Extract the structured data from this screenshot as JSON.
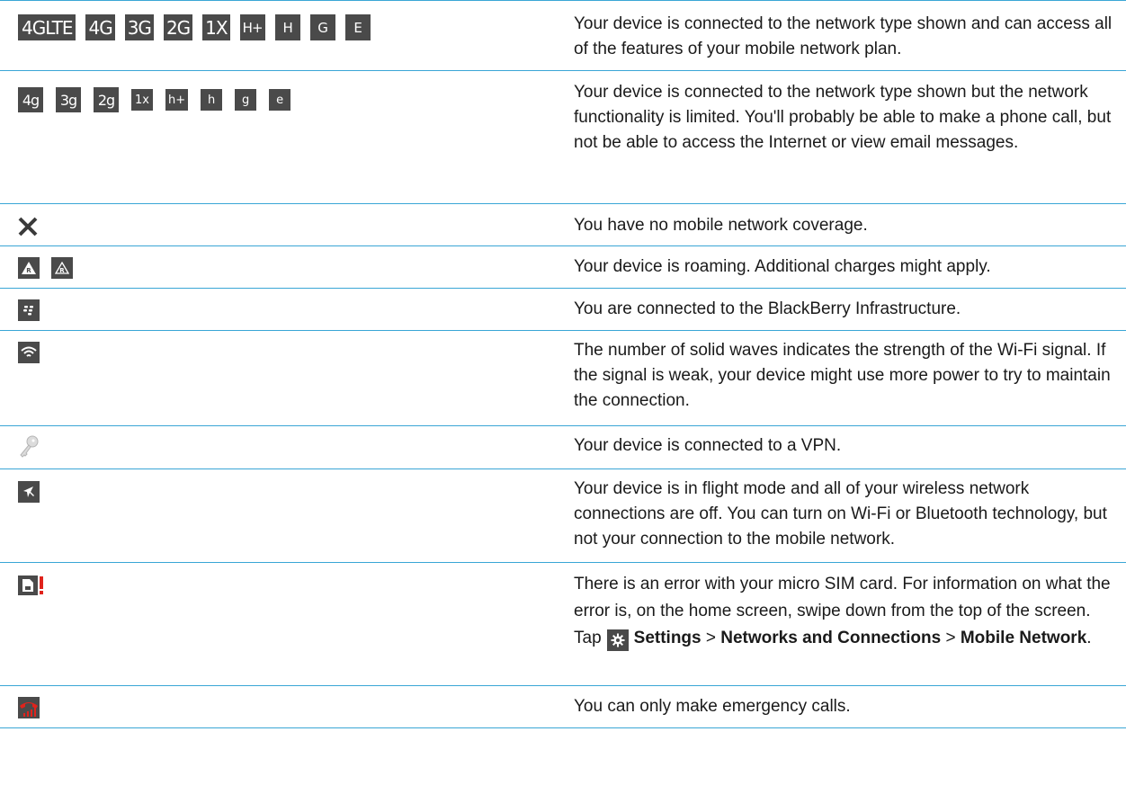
{
  "rows": [
    {
      "icons": [
        "4GLTE",
        "4G",
        "3G",
        "2G",
        "1X",
        "H+",
        "H",
        "G",
        "E"
      ],
      "text": "Your device is connected to the network type shown and can access all of the features of your mobile network plan."
    },
    {
      "icons": [
        "4g",
        "3g",
        "2g",
        "1x",
        "h+",
        "h",
        "g",
        "e"
      ],
      "text": "Your device is connected to the network type shown but the network functionality is limited. You'll probably be able to make a phone call, but not be able to access the Internet or view email messages."
    },
    {
      "icons": [
        "no-coverage-icon"
      ],
      "text": "You have no mobile network coverage."
    },
    {
      "icons": [
        "roaming-icon",
        "roaming-outline-icon"
      ],
      "text": "Your device is roaming. Additional charges might apply."
    },
    {
      "icons": [
        "blackberry-icon"
      ],
      "text": "You are connected to the BlackBerry Infrastructure."
    },
    {
      "icons": [
        "wifi-icon"
      ],
      "text": "The number of solid waves indicates the strength of the Wi-Fi signal. If the signal is weak, your device might use more power to try to maintain the connection."
    },
    {
      "icons": [
        "vpn-key-icon"
      ],
      "text": "Your device is connected to a VPN."
    },
    {
      "icons": [
        "airplane-icon"
      ],
      "text": "Your device is in flight mode and all of your wireless network connections are off. You can turn on Wi-Fi or Bluetooth technology, but not your connection to the mobile network."
    },
    {
      "icons": [
        "sim-error-icon"
      ],
      "text_before": "There is an error with your micro SIM card. For information on what the error is, on the home screen, swipe down from the top of the screen. Tap",
      "settings": "Settings",
      "sep1": ">",
      "networks": "Networks and Connections",
      "sep2": ">",
      "mobile": "Mobile Network",
      "end": "."
    },
    {
      "icons": [
        "emergency-call-icon"
      ],
      "text": "You can only make emergency calls."
    }
  ],
  "colors": {
    "rule": "#3aa6d6",
    "icon_bg": "#4a4a4a",
    "alert": "#e0231c"
  }
}
